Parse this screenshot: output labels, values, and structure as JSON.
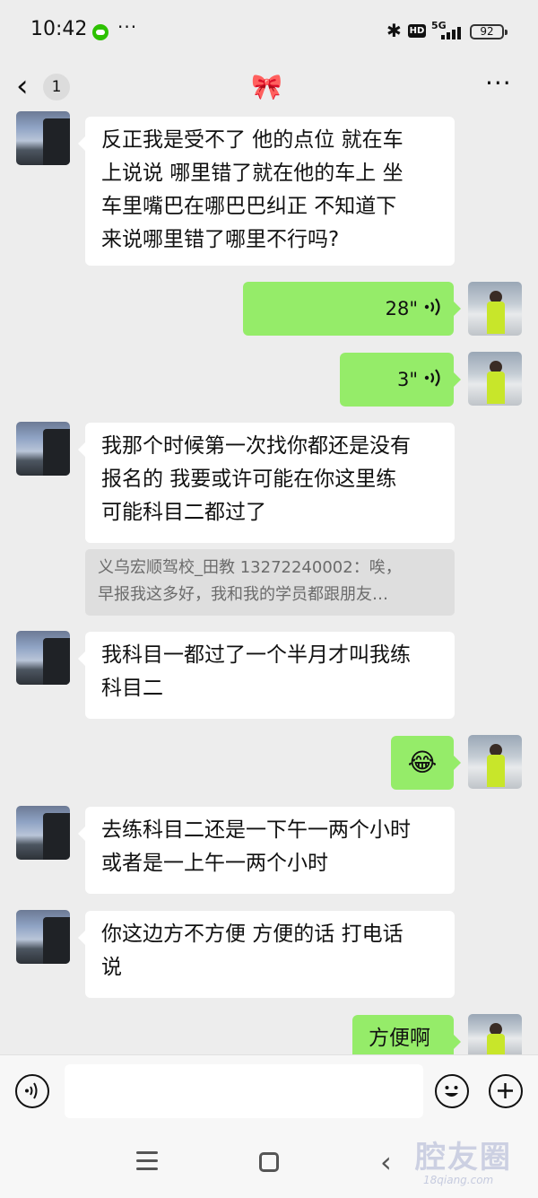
{
  "status_bar": {
    "time": "10:42",
    "dots": "···",
    "hd": "HD",
    "network": "5G",
    "battery": "92"
  },
  "header": {
    "back_glyph": "‹",
    "unread_count": "1",
    "title": "🎀",
    "more": "···"
  },
  "messages": [
    {
      "from": "other",
      "type": "text",
      "lines": [
        "反正我是受不了 他的点位 就在车",
        "上说说 哪里错了就在他的车上 坐",
        "车里嘴巴在哪巴巴纠正 不知道下",
        "来说哪里错了哪里不行吗?"
      ]
    },
    {
      "from": "self",
      "type": "voice",
      "duration": "28\""
    },
    {
      "from": "self",
      "type": "voice",
      "duration": "3\""
    },
    {
      "from": "other",
      "type": "text",
      "lines": [
        "我那个时候第一次找你都还是没有",
        "报名的 我要或许可能在你这里练",
        "可能科目二都过了"
      ]
    },
    {
      "from": "quote",
      "type": "quote",
      "lines": [
        "义乌宏顺驾校_田教 13272240002：唉，",
        "早报我这多好，我和我的学员都跟朋友…"
      ]
    },
    {
      "from": "other",
      "type": "text",
      "lines": [
        "我科目一都过了一个半月才叫我练",
        "科目二"
      ]
    },
    {
      "from": "self",
      "type": "emoji",
      "emoji": "😂"
    },
    {
      "from": "other",
      "type": "text",
      "lines": [
        "去练科目二还是一下午一两个小时",
        "或者是一上午一两个小时"
      ]
    },
    {
      "from": "other",
      "type": "text",
      "lines": [
        "你这边方不方便 方便的话 打电话",
        "说"
      ]
    },
    {
      "from": "self",
      "type": "text",
      "lines": [
        "方便啊"
      ]
    }
  ],
  "input_bar": {
    "placeholder": ""
  },
  "watermark": {
    "main": "腔友圈",
    "sub": "18qiang.com"
  }
}
